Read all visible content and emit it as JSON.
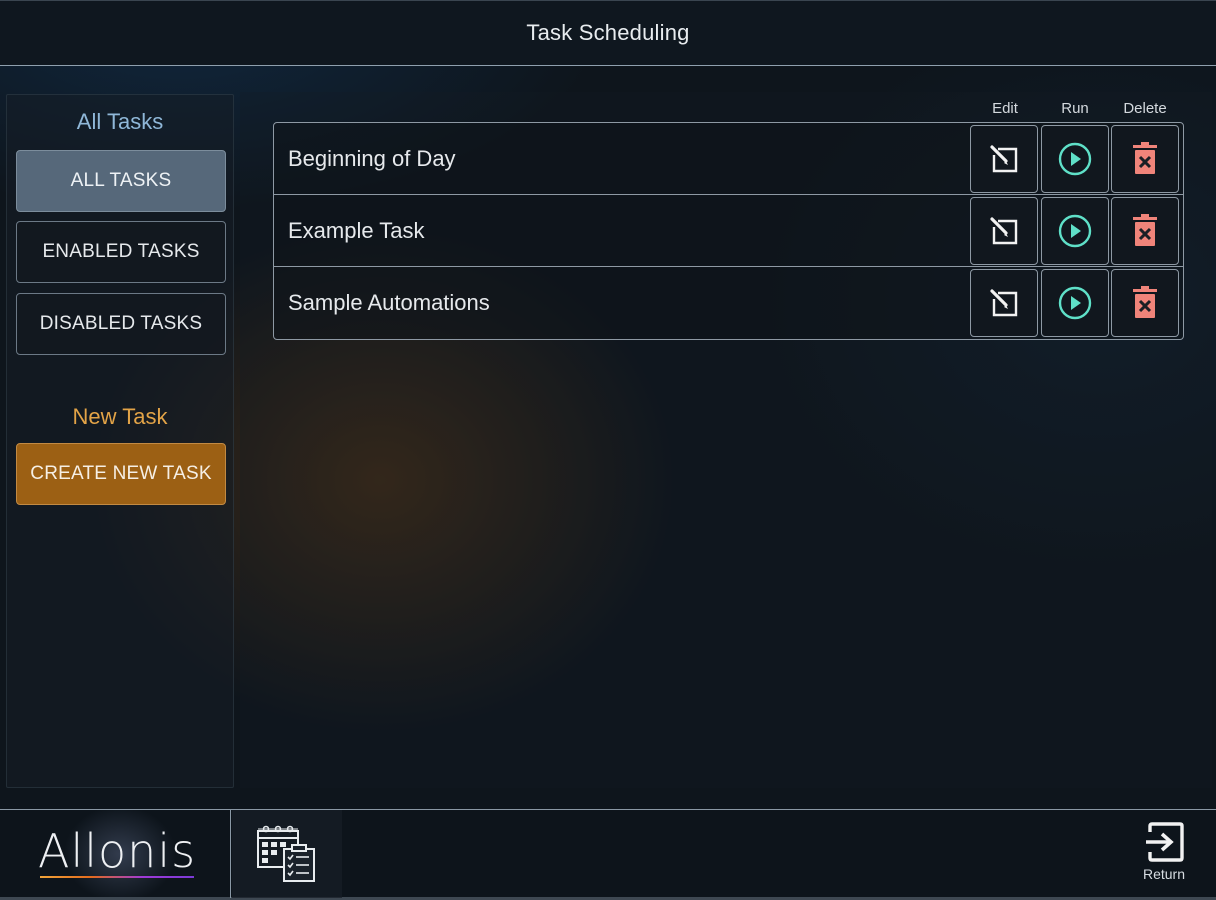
{
  "header": {
    "title": "Task Scheduling"
  },
  "sidebar": {
    "section_all": "All Tasks",
    "buttons": [
      {
        "label": "ALL TASKS",
        "active": true
      },
      {
        "label": "ENABLED TASKS",
        "active": false
      },
      {
        "label": "DISABLED TASKS",
        "active": false
      }
    ],
    "section_new": "New Task",
    "create_label": "CREATE NEW TASK"
  },
  "table": {
    "columns": {
      "edit": "Edit",
      "run": "Run",
      "delete": "Delete"
    },
    "tasks": [
      {
        "name": "Beginning of Day"
      },
      {
        "name": "Example Task"
      },
      {
        "name": "Sample Automations"
      }
    ]
  },
  "footer": {
    "logo": "Allonis",
    "calendar_icon": "calendar-tasks-icon",
    "return_label": "Return"
  },
  "colors": {
    "accent_orange": "#9c6014",
    "run_icon": "#5fe0c8",
    "delete_icon": "#f0847a",
    "section_blue": "#8fb7d8",
    "section_orange": "#e2a347"
  }
}
